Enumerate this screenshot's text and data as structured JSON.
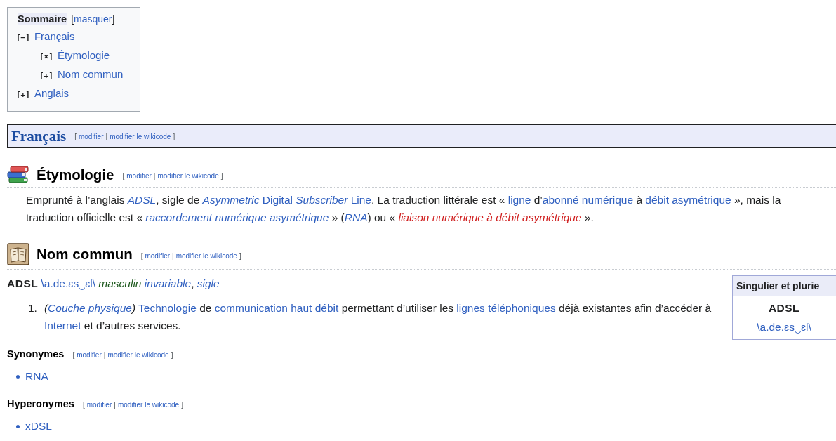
{
  "toc": {
    "title": "Sommaire",
    "hide": {
      "open": "[",
      "label": "masquer",
      "close": "]"
    },
    "items": [
      {
        "toggle": "[−]",
        "label": "Français",
        "children": [
          {
            "toggle": "[×]",
            "label": "Étymologie"
          },
          {
            "toggle": "[+]",
            "label": "Nom commun"
          }
        ]
      },
      {
        "toggle": "[+]",
        "label": "Anglais"
      }
    ]
  },
  "language": {
    "title": "Français",
    "edit": {
      "open": "[",
      "links": [
        "modifier",
        "modifier le wikicode"
      ],
      "separator": "|",
      "close": "]"
    }
  },
  "sections": [
    {
      "title": "Étymologie",
      "edit": {
        "open": "[",
        "links": [
          "modifier",
          "modifier le wikicode"
        ],
        "separator": "|",
        "close": "]"
      },
      "paragraph": [
        {
          "text": "Emprunté à l’anglais ",
          "kind": "plain"
        },
        {
          "text": "ADSL",
          "kind": "link-italic"
        },
        {
          "text": ", sigle de ",
          "kind": "plain"
        },
        {
          "text": "*Asymmetric* Digital *Subscriber* Line",
          "kind": "link"
        },
        {
          "text": ". La traduction littérale est « ",
          "kind": "plain"
        },
        {
          "text": "ligne",
          "kind": "link"
        },
        {
          "text": " d’",
          "kind": "plain"
        },
        {
          "text": "abonné numérique",
          "kind": "link"
        },
        {
          "text": " à ",
          "kind": "plain"
        },
        {
          "text": "débit asymétrique",
          "kind": "link"
        },
        {
          "text": " », mais la traduction officielle est « ",
          "kind": "plain"
        },
        {
          "text": "raccordement numérique asymétrique",
          "kind": "link-italic"
        },
        {
          "text": " » (",
          "kind": "plain"
        },
        {
          "text": "RNA",
          "kind": "link-italic"
        },
        {
          "text": ") ou « ",
          "kind": "plain"
        },
        {
          "text": "liaison numérique à débit asymétrique",
          "kind": "redlink-italic"
        },
        {
          "text": " ».",
          "kind": "plain"
        }
      ]
    },
    {
      "title": "Nom commun",
      "edit": {
        "open": "[",
        "links": [
          "modifier",
          "modifier le wikicode"
        ],
        "separator": "|",
        "close": "]"
      },
      "inflection_table": {
        "header": "Singulier et plurie",
        "word": "ADSL",
        "pronunciation": "\\a.de.ɛs‿ɛl\\"
      },
      "headword": {
        "word": "ADSL",
        "pronunciation": "\\a.de.ɛs‿ɛl\\",
        "gender": "masculin",
        "labels": [
          "invariable",
          "sigle"
        ],
        "label_separator": ","
      },
      "definitions": [
        {
          "number": "1.",
          "context": {
            "open": "(",
            "label": "Couche physique",
            "close": ")"
          },
          "text": [
            {
              "text": "Technologie",
              "kind": "link"
            },
            {
              "text": " de ",
              "kind": "plain"
            },
            {
              "text": "communication haut débit",
              "kind": "link"
            },
            {
              "text": " permettant d’utiliser les ",
              "kind": "plain"
            },
            {
              "text": "lignes téléphoniques",
              "kind": "link"
            },
            {
              "text": " déjà existantes afin d’accéder à ",
              "kind": "plain"
            },
            {
              "text": "Internet",
              "kind": "link"
            },
            {
              "text": " et d’autres services.",
              "kind": "plain"
            }
          ]
        }
      ],
      "subsections": [
        {
          "title": "Synonymes",
          "edit": {
            "open": "[",
            "links": [
              "modifier",
              "modifier le wikicode"
            ],
            "separator": "|",
            "close": "]"
          },
          "items": [
            "RNA"
          ]
        },
        {
          "title": "Hyperonymes",
          "edit": {
            "open": "[",
            "links": [
              "modifier",
              "modifier le wikicode"
            ],
            "separator": "|",
            "close": "]"
          },
          "items": [
            "xDSL"
          ]
        }
      ]
    }
  ]
}
